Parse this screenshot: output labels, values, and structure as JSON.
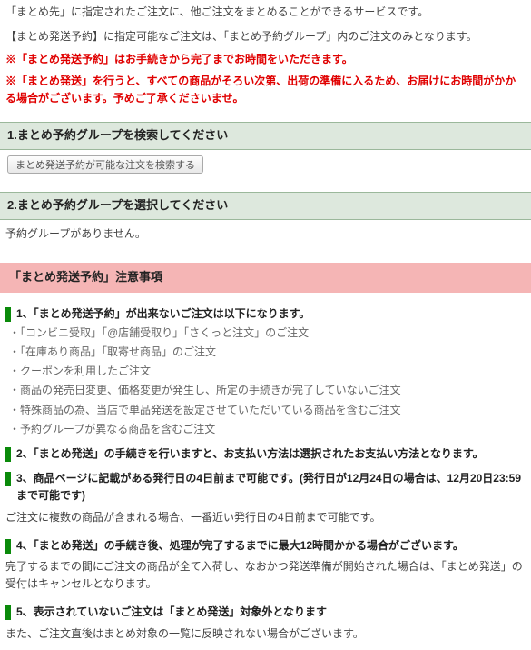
{
  "intro": {
    "line1": "「まとめ先」に指定されたご注文に、他ご注文をまとめることができるサービスです。",
    "line2": "【まとめ発送予約】に指定可能なご注文は、「まとめ予約グループ」内のご注文のみとなります。"
  },
  "warnings": {
    "w1": "※「まとめ発送予約」はお手続きから完了までお時間をいただきます。",
    "w2": "※「まとめ発送」を行うと、すべての商品がそろい次第、出荷の準備に入るため、お届けにお時間がかかる場合がございます。予めご了承くださいませ。"
  },
  "section1": {
    "title": "1.まとめ予約グループを検索してください",
    "button": "まとめ発送予約が可能な注文を検索する"
  },
  "section2": {
    "title": "2.まとめ予約グループを選択してください",
    "empty": "予約グループがありません。"
  },
  "notice": {
    "header": "「まとめ発送予約」注意事項",
    "item1": {
      "title": "1、「まとめ発送予約」が出来ないご注文は以下になります。",
      "b1": "・「コンビニ受取」「@店舗受取り」「さくっと注文」のご注文",
      "b2": "・「在庫あり商品」「取寄せ商品」のご注文",
      "b3": "・クーポンを利用したご注文",
      "b4": "・商品の発売日変更、価格変更が発生し、所定の手続きが完了していないご注文",
      "b5": "・特殊商品の為、当店で単品発送を設定させていただいている商品を含むご注文",
      "b6": "・予約グループが異なる商品を含むご注文"
    },
    "item2": {
      "title": "2、「まとめ発送」の手続きを行いますと、お支払い方法は選択されたお支払い方法となります。"
    },
    "item3": {
      "title": "3、商品ページに記載がある発行日の4日前まで可能です。(発行日が12月24日の場合は、12月20日23:59まで可能です)",
      "sub": "ご注文に複数の商品が含まれる場合、一番近い発行日の4日前まで可能です。"
    },
    "item4": {
      "title": "4、「まとめ発送」の手続き後、処理が完了するまでに最大12時間かかる場合がございます。",
      "sub": "完了するまでの間にご注文の商品が全て入荷し、なおかつ発送準備が開始された場合は、「まとめ発送」の受付はキャンセルとなります。"
    },
    "item5": {
      "title": "5、表示されていないご注文は「まとめ発送」対象外となります",
      "sub": "また、ご注文直後はまとめ対象の一覧に反映されない場合がございます。"
    }
  }
}
